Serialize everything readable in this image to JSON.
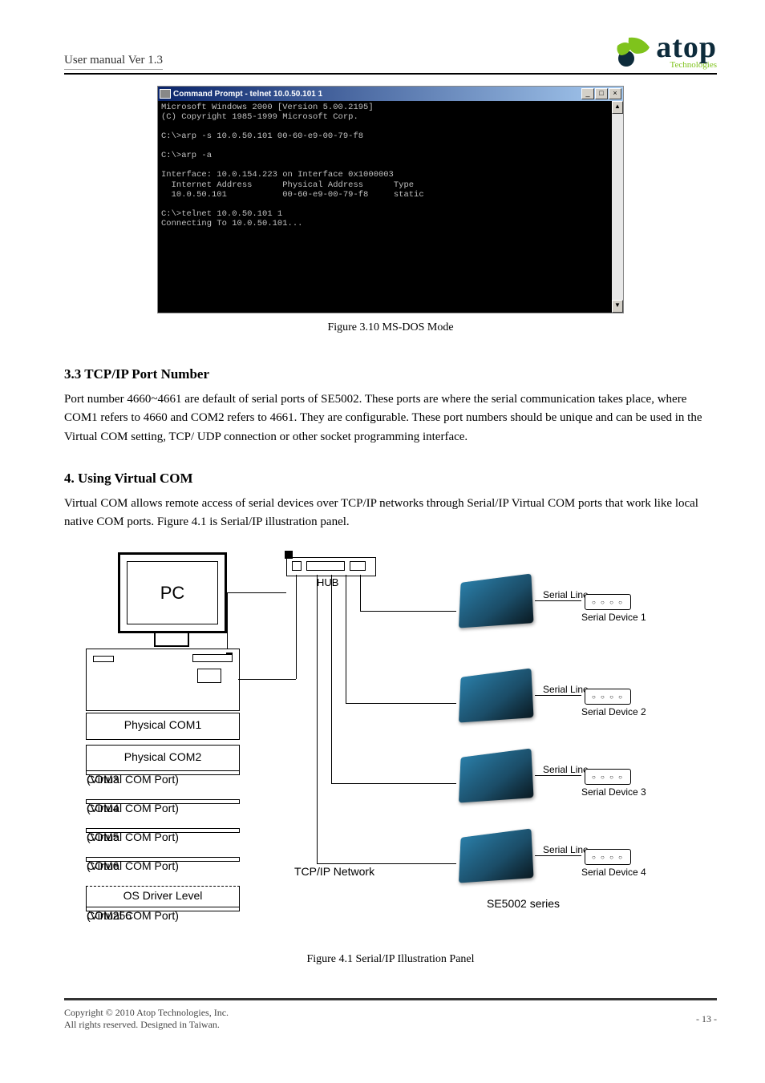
{
  "header": {
    "left": "User manual Ver 1.3",
    "logo_main": "atop",
    "logo_sub": "Technologies"
  },
  "cmd": {
    "title": "Command Prompt - telnet 10.0.50.101 1",
    "body": "Microsoft Windows 2000 [Version 5.00.2195]\n(C) Copyright 1985-1999 Microsoft Corp.\n\nC:\\>arp -s 10.0.50.101 00-60-e9-00-79-f8\n\nC:\\>arp -a\n\nInterface: 10.0.154.223 on Interface 0x1000003\n  Internet Address      Physical Address      Type\n  10.0.50.101           00-60-e9-00-79-f8     static\n\nC:\\>telnet 10.0.50.101 1\nConnecting To 10.0.50.101...",
    "controls": {
      "min": "_",
      "max": "□",
      "close": "×"
    },
    "scroll": {
      "up": "▲",
      "down": "▼"
    }
  },
  "figure3_10_caption": "Figure 3.10 MS-DOS Mode",
  "section_3_3": {
    "heading": "3.3 TCP/IP Port Number",
    "body": "Port number 4660~4661 are default of serial ports of SE5002. These ports are where the serial communication takes place, where COM1 refers to 4660 and COM2 refers to 4661. They are configurable. These port numbers should be unique and can be used in the Virtual COM setting, TCP/ UDP connection or other socket programming interface."
  },
  "section_4": {
    "heading": "4. Using Virtual COM",
    "body": "Virtual COM allows remote access of serial devices over TCP/IP networks through Serial/IP Virtual COM ports that work like local native COM ports. Figure 4.1 is Serial/IP illustration panel."
  },
  "diagram": {
    "pc_label": "PC",
    "hub_label": "HUB",
    "physical_com1": "Physical COM1",
    "physical_com2": "Physical COM2",
    "com3": {
      "l1": "COM3",
      "l2": "(Virtual COM Port)"
    },
    "com4": {
      "l1": "COM4",
      "l2": "(Virtual COM Port)"
    },
    "com5": {
      "l1": "COM5",
      "l2": "(Virtual COM Port)"
    },
    "com6": {
      "l1": "COM6",
      "l2": "(Virtual COM Port)"
    },
    "os_driver": "OS Driver Level",
    "com256": {
      "l1": "COM256",
      "l2": "(Virtual COM Port)"
    },
    "tcpip": "TCP/IP Network",
    "serial_line": "Serial Line",
    "dev1": "Serial Device 1",
    "dev2": "Serial Device 2",
    "dev3": "Serial Device 3",
    "dev4": "Serial Device 4",
    "series": "SE5002 series"
  },
  "figure4_1_caption": "Figure 4.1 Serial/IP Illustration Panel",
  "footer": {
    "copyright": "Copyright © 2010 Atop Technologies, Inc.",
    "rights": "All rights reserved. Designed in Taiwan.",
    "page": "- 13 -"
  }
}
